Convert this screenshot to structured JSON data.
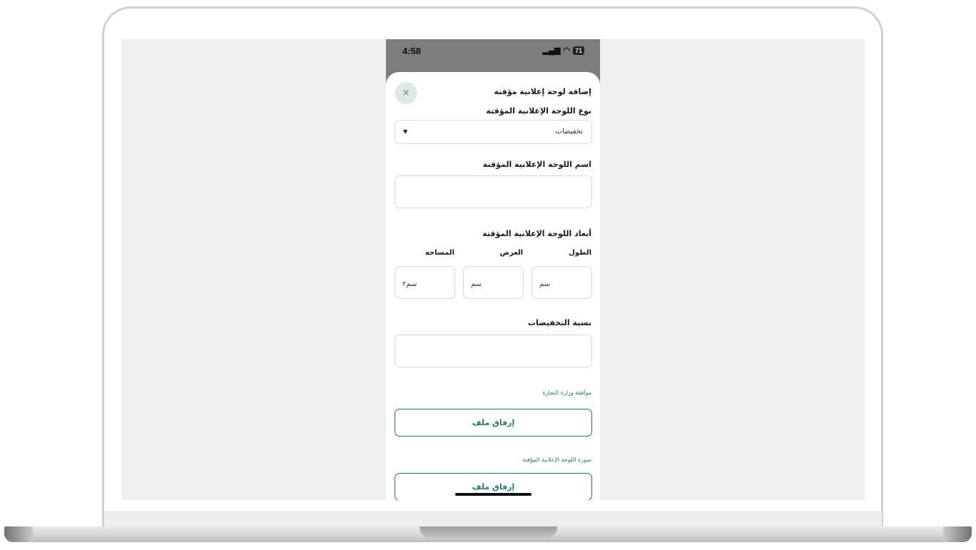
{
  "status_bar": {
    "time": "4:58",
    "signal": "▂▄▆",
    "wifi": "◠",
    "battery": "71"
  },
  "sheet": {
    "title": "إضافة لوحة إعلانية مؤقتة",
    "close_icon": "×",
    "type_field": {
      "label": "نوع اللوحة الإعلانية المؤقتة",
      "value": "تخفيضات",
      "caret": "▼"
    },
    "name_field": {
      "label": "اسم اللوحة الإعلانية المؤقتة",
      "value": ""
    },
    "dimensions": {
      "label": "أبعاد اللوحة الإعلانية المؤقتة",
      "length_label": "الطول",
      "width_label": "العرض",
      "area_label": "المساحه",
      "length_unit": "سم",
      "width_unit": "سم",
      "area_unit": "سم٢"
    },
    "discount_field": {
      "label": "نسبة التخفيضات",
      "value": ""
    },
    "ministry_approval": {
      "label": "موافقة وزارة التجارة",
      "button": "إرفاق ملف"
    },
    "board_image": {
      "label": "صورة اللوحة الإعلانية المؤقتة",
      "button": "إرفاق ملف"
    }
  }
}
